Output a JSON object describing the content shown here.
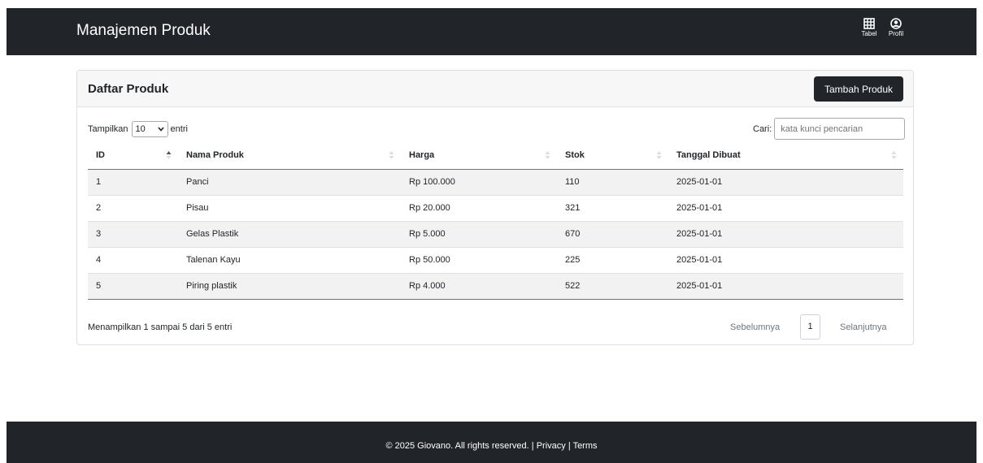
{
  "navbar": {
    "brand": "Manajemen Produk",
    "items": [
      {
        "label": "Tabel",
        "icon": "table-icon"
      },
      {
        "label": "Profil",
        "icon": "user-circle-icon"
      }
    ]
  },
  "card": {
    "title": "Daftar Produk",
    "add_button": "Tambah Produk"
  },
  "controls": {
    "length_prefix": "Tampilkan",
    "length_value": "10",
    "length_suffix": "entri",
    "search_label": "Cari:",
    "search_placeholder": "kata kunci pencarian"
  },
  "table": {
    "columns": [
      "ID",
      "Nama Produk",
      "Harga",
      "Stok",
      "Tanggal Dibuat"
    ],
    "rows": [
      [
        "1",
        "Panci",
        "Rp 100.000",
        "110",
        "2025-01-01"
      ],
      [
        "2",
        "Pisau",
        "Rp 20.000",
        "321",
        "2025-01-01"
      ],
      [
        "3",
        "Gelas Plastik",
        "Rp 5.000",
        "670",
        "2025-01-01"
      ],
      [
        "4",
        "Talenan Kayu",
        "Rp 50.000",
        "225",
        "2025-01-01"
      ],
      [
        "5",
        "Piring plastik",
        "Rp 4.000",
        "522",
        "2025-01-01"
      ]
    ]
  },
  "info": "Menampilkan 1 sampai 5 dari 5 entri",
  "pagination": {
    "prev": "Sebelumnya",
    "current": "1",
    "next": "Selanjutnya"
  },
  "footer": {
    "copyright": "© 2025 Giovano. All rights reserved.",
    "privacy": "Privacy",
    "terms": "Terms"
  },
  "colors": {
    "dark": "#212529",
    "stripe": "#f2f2f2"
  }
}
